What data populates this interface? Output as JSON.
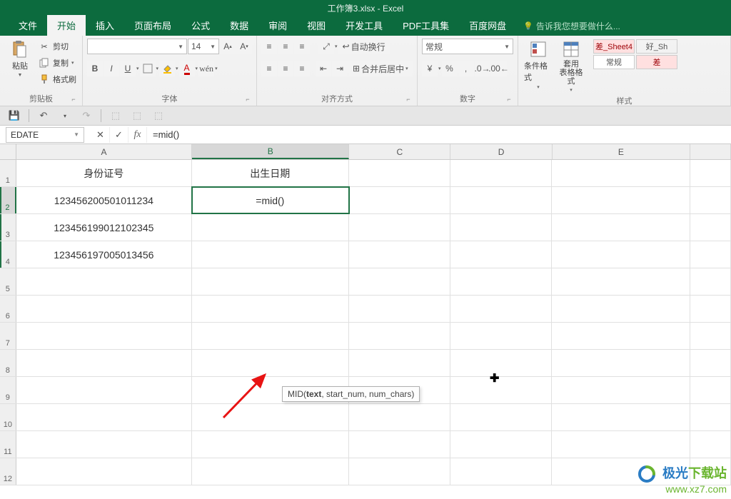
{
  "title": "工作簿3.xlsx - Excel",
  "tabs": [
    "文件",
    "开始",
    "插入",
    "页面布局",
    "公式",
    "数据",
    "审阅",
    "视图",
    "开发工具",
    "PDF工具集",
    "百度网盘"
  ],
  "tell_me": "告诉我您想要做什么...",
  "clipboard": {
    "paste": "粘贴",
    "cut": "剪切",
    "copy": "复制",
    "format": "格式刷",
    "label": "剪贴板"
  },
  "font": {
    "size": "14",
    "bold": "B",
    "italic": "I",
    "underline": "U",
    "label": "字体"
  },
  "align": {
    "wrap": "自动换行",
    "merge": "合并后居中",
    "label": "对齐方式"
  },
  "number": {
    "general": "常规",
    "label": "数字"
  },
  "styles": {
    "cond": "条件格式",
    "table": "套用\n表格格式",
    "s1": "差_Sheet4",
    "s2": "好_Sh",
    "s3": "常规",
    "s4": "差",
    "label": "样式"
  },
  "namebox": "EDATE",
  "formula": "=mid()",
  "columns": [
    "A",
    "B",
    "C",
    "D",
    "E"
  ],
  "rows": {
    "1": {
      "A": "身份证号",
      "B": "出生日期"
    },
    "2": {
      "A": "123456200501011234",
      "B": "=mid()"
    },
    "3": {
      "A": "123456199012102345"
    },
    "4": {
      "A": "123456197005013456"
    }
  },
  "tooltip": {
    "fn": "MID",
    "args": "(text, start_num, num_chars)",
    "bold": "text"
  },
  "watermark": {
    "line1a": "极光",
    "line1b": "下载站",
    "line2": "www.xz7.com"
  }
}
